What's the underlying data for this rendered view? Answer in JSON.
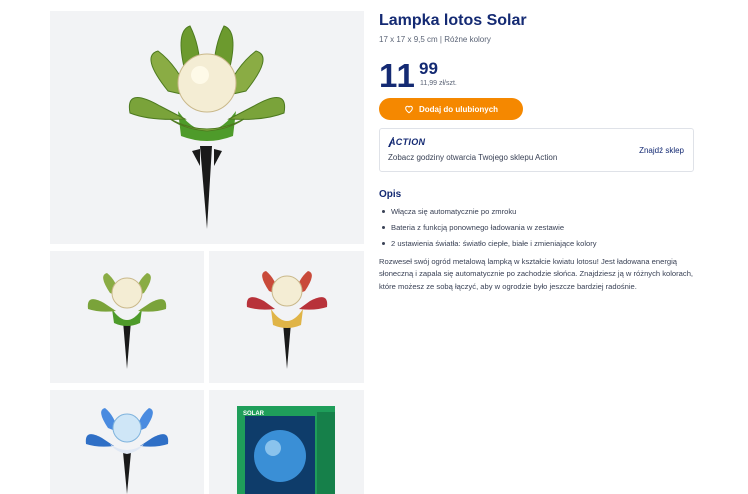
{
  "product": {
    "title": "Lampka lotos Solar",
    "subtitle": "17 x 17 x 9,5 cm | Różne kolory",
    "price_int": "11",
    "price_dec": "99",
    "unit_price": "11,99 zł/szt."
  },
  "actions": {
    "favorite_label": "Dodaj do ulubionych"
  },
  "store": {
    "brand": "ACTION",
    "hours_text": "Zobacz godziny otwarcia Twojego sklepu Action",
    "find_store_label": "Znajdź sklep"
  },
  "description": {
    "heading": "Opis",
    "bullets": [
      "Włącza się automatycznie po zmroku",
      "Bateria z funkcją ponownego ładowania w zestawie",
      "2 ustawienia światła: światło ciepłe, białe i zmieniające kolory"
    ],
    "body": "Rozweseł swój ogród metalową lampką w kształcie kwiatu lotosu! Jest ładowana energią słoneczną i zapala się automatycznie po zachodzie słońca. Znajdziesz ją w różnych kolorach, które możesz ze sobą łączyć, aby w ogrodzie było jeszcze bardziej radośnie."
  },
  "gallery": {
    "box_label": "SOLAR"
  },
  "colors": {
    "brand_navy": "#142a73",
    "accent_orange": "#f58800",
    "tile_bg": "#f2f3f5",
    "lamp_green": "#6cb23a",
    "lamp_red": "#b8323a",
    "lamp_blue": "#2f6fc6"
  }
}
